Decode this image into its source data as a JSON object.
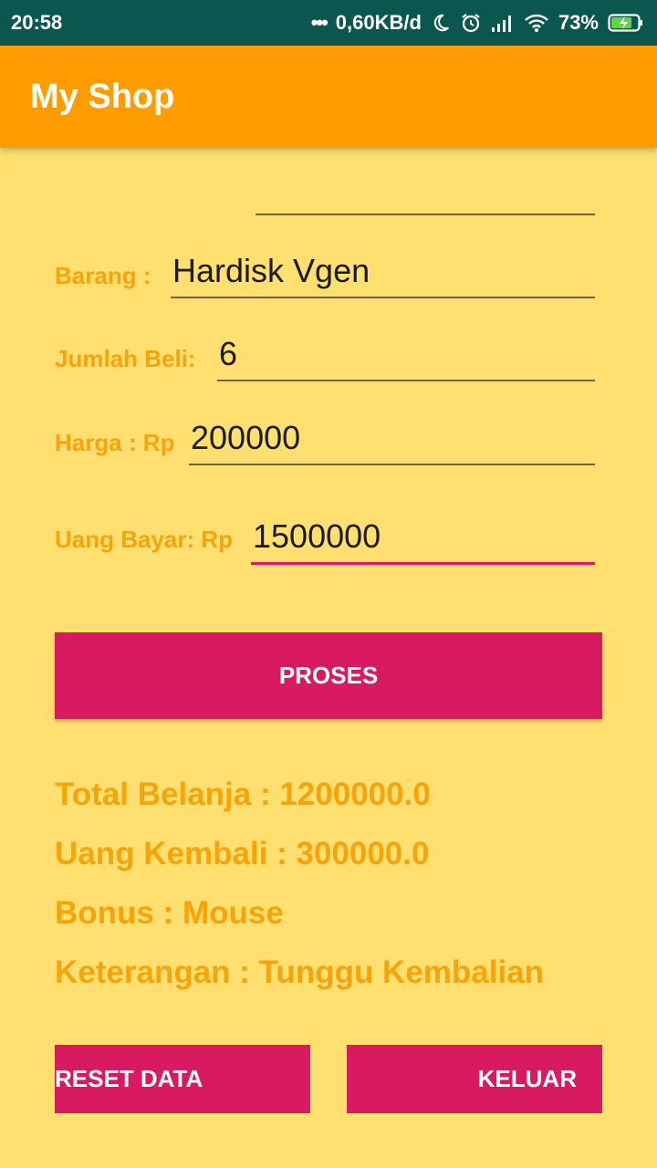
{
  "status": {
    "time": "20:58",
    "dots": "•••",
    "speed": "0,60KB/d",
    "battery": "73%",
    "icons": [
      "moon-icon",
      "alarm-icon",
      "signal-icon",
      "wifi-icon",
      "battery-charging-icon"
    ]
  },
  "appbar": {
    "title": "My Shop"
  },
  "form": {
    "top_field": {
      "value": ""
    },
    "barang": {
      "label": "Barang :",
      "value": "Hardisk Vgen"
    },
    "jumlah": {
      "label": "Jumlah Beli:",
      "value": "6"
    },
    "harga": {
      "label": "Harga : Rp",
      "value": "200000"
    },
    "bayar": {
      "label": "Uang Bayar: Rp",
      "value": "1500000"
    }
  },
  "buttons": {
    "proses": "PROSES",
    "reset": "RESET DATA",
    "keluar": "KELUAR"
  },
  "results": {
    "total": "Total Belanja : 1200000.0",
    "kembali": "Uang Kembali : 300000.0",
    "bonus": "Bonus : Mouse",
    "keterangan": "Keterangan : Tunggu Kembalian"
  },
  "colors": {
    "background": "#FEDF6F",
    "appbar": "#FF9C00",
    "statusbar": "#0B574F",
    "accent": "#D81B60",
    "label": "#F7A40B"
  }
}
